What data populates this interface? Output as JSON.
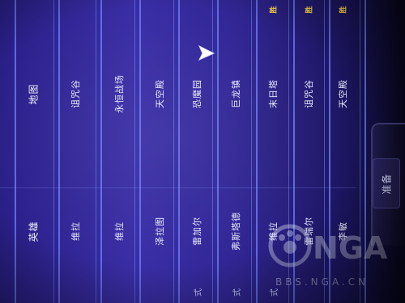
{
  "table": {
    "header": {
      "map": "地图",
      "hero": "英雄"
    },
    "rows": [
      {
        "map": "诅咒谷",
        "hero": "维拉",
        "result": ""
      },
      {
        "map": "永恒战场",
        "hero": "维拉",
        "result": ""
      },
      {
        "map": "天空殿",
        "hero": "泽拉图",
        "result": ""
      },
      {
        "map": "恐魔园",
        "hero": "雷加尔",
        "result": ""
      },
      {
        "map": "巨龙镇",
        "hero": "弗斯塔德",
        "result": ""
      },
      {
        "map": "末日塔",
        "hero": "维拉",
        "result": "胜"
      },
      {
        "map": "诅咒谷",
        "hero": "雷瑞尔",
        "result": "胜"
      },
      {
        "map": "天空殿",
        "hero": "李敏",
        "result": "胜"
      }
    ],
    "edge_fragments": [
      "式",
      "式",
      "式"
    ]
  },
  "buttons": {
    "confirm": "准备"
  },
  "watermark": {
    "logo": "NGA",
    "url": "BBS.NGA.CN"
  },
  "colors": {
    "background": "#312695",
    "grid_line": "#6d83ff",
    "text": "#e6e9ff",
    "victory": "#ffd84d"
  },
  "icons": {
    "cursor": "mouse-cursor-icon"
  }
}
